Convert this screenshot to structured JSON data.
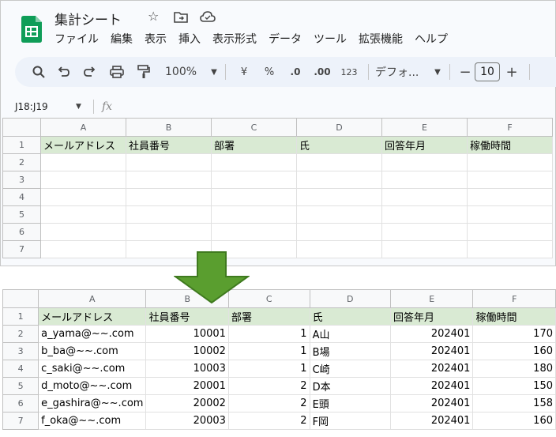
{
  "app": {
    "title": "集計シート",
    "icons": [
      "star-icon",
      "move-to-folder-icon",
      "cloud-status-icon"
    ],
    "brand_color": "#0f9d58"
  },
  "menu": [
    "ファイル",
    "編集",
    "表示",
    "挿入",
    "表示形式",
    "データ",
    "ツール",
    "拡張機能",
    "ヘルプ"
  ],
  "toolbar": {
    "zoom": "100%",
    "currency": "¥",
    "percent": "%",
    "dec_decrease": ".0",
    "dec_increase": ".00",
    "format_123": "123",
    "font": "デフォ...",
    "font_size": "10",
    "minus": "−",
    "plus": "+"
  },
  "formula_bar": {
    "name_box": "J18:J19",
    "fx": "fx"
  },
  "columns": [
    "A",
    "B",
    "C",
    "D",
    "E",
    "F"
  ],
  "header_row": [
    "メールアドレス",
    "社員番号",
    "部署",
    "氏",
    "回答年月",
    "稼働時間"
  ],
  "header_color": "#d9ead3",
  "sheet_before": {
    "row_numbers": [
      "1",
      "2",
      "3",
      "4",
      "5",
      "6",
      "7"
    ]
  },
  "sheet_after": {
    "row_numbers": [
      "1",
      "2",
      "3",
      "4",
      "5",
      "6",
      "7"
    ],
    "rows": [
      [
        "a_yama@~~.com",
        "10001",
        "1",
        "A山",
        "202401",
        "170"
      ],
      [
        "b_ba@~~.com",
        "10002",
        "1",
        "B場",
        "202401",
        "160"
      ],
      [
        "c_saki@~~.com",
        "10003",
        "1",
        "C崎",
        "202401",
        "180"
      ],
      [
        "d_moto@~~.com",
        "20001",
        "2",
        "D本",
        "202401",
        "150"
      ],
      [
        "e_gashira@~~.com",
        "20002",
        "2",
        "E頭",
        "202401",
        "158"
      ],
      [
        "f_oka@~~.com",
        "20003",
        "2",
        "F岡",
        "202401",
        "160"
      ]
    ]
  },
  "arrow_color": "#5a9e2f"
}
